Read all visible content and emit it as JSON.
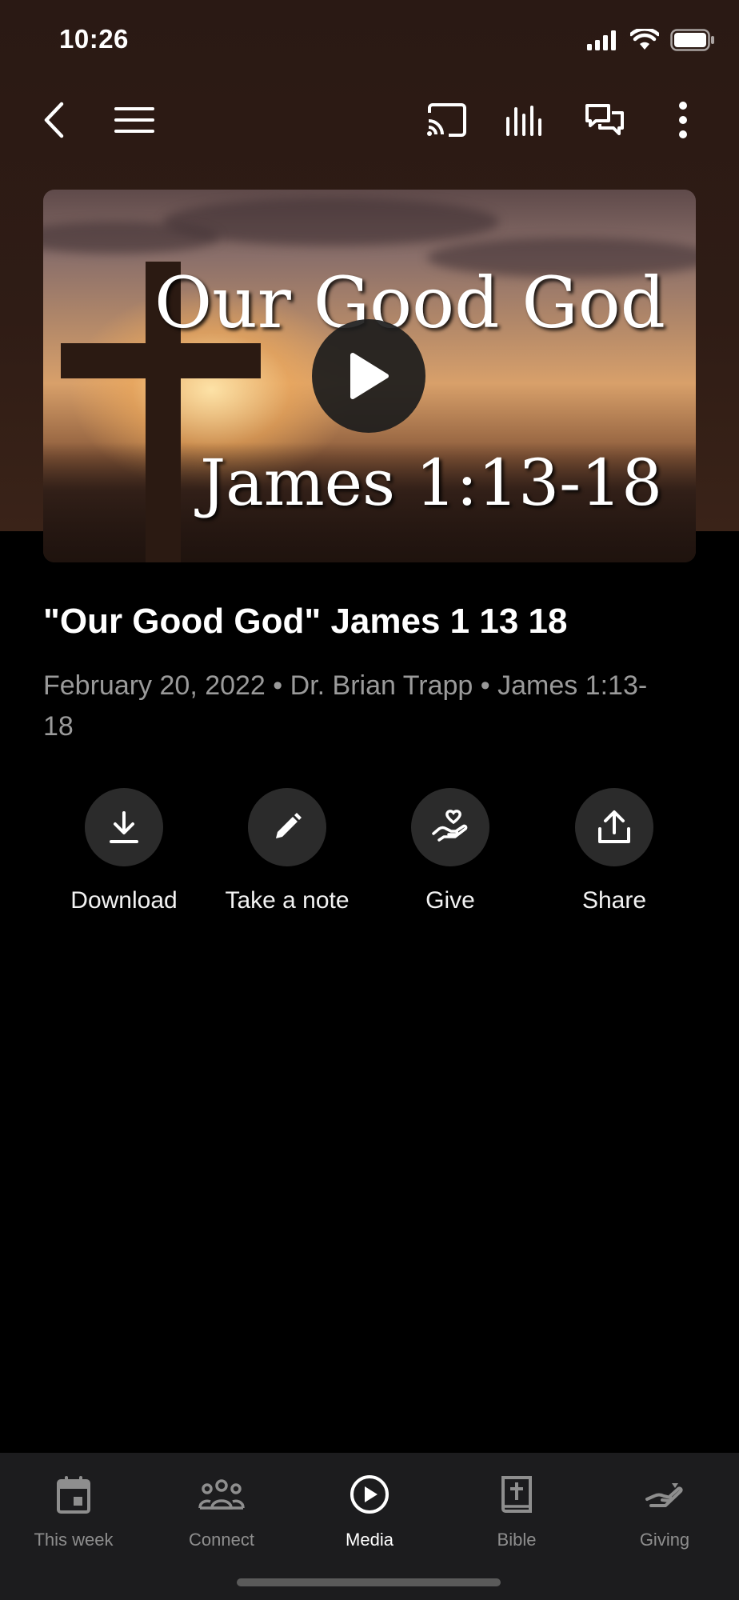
{
  "status_bar": {
    "time": "10:26"
  },
  "nav": {
    "icons": [
      "back-icon",
      "menu-icon",
      "cast-icon",
      "audio-icon",
      "chat-icon",
      "more-icon"
    ]
  },
  "video": {
    "thumbnail_title": "Our Good God",
    "thumbnail_reference": "James 1:13-18",
    "play_icon": "play-icon"
  },
  "sermon": {
    "title": "\"Our Good God\" James 1 13 18",
    "meta": "February 20, 2022 • Dr. Brian Trapp • James 1:13-18"
  },
  "actions": [
    {
      "label": "Download",
      "icon": "download-icon"
    },
    {
      "label": "Take a note",
      "icon": "pencil-icon"
    },
    {
      "label": "Give",
      "icon": "heart-hand-icon"
    },
    {
      "label": "Share",
      "icon": "share-icon"
    }
  ],
  "tabs": [
    {
      "label": "This week",
      "icon": "calendar-icon",
      "active": false
    },
    {
      "label": "Connect",
      "icon": "people-icon",
      "active": false
    },
    {
      "label": "Media",
      "icon": "play-circle-icon",
      "active": true
    },
    {
      "label": "Bible",
      "icon": "bible-icon",
      "active": false
    },
    {
      "label": "Giving",
      "icon": "giving-icon",
      "active": false
    }
  ],
  "colors": {
    "background": "#000000",
    "header_bg": "#2f1c15",
    "muted_text": "#9a9a9a",
    "tab_bar_bg": "#1c1c1e"
  }
}
